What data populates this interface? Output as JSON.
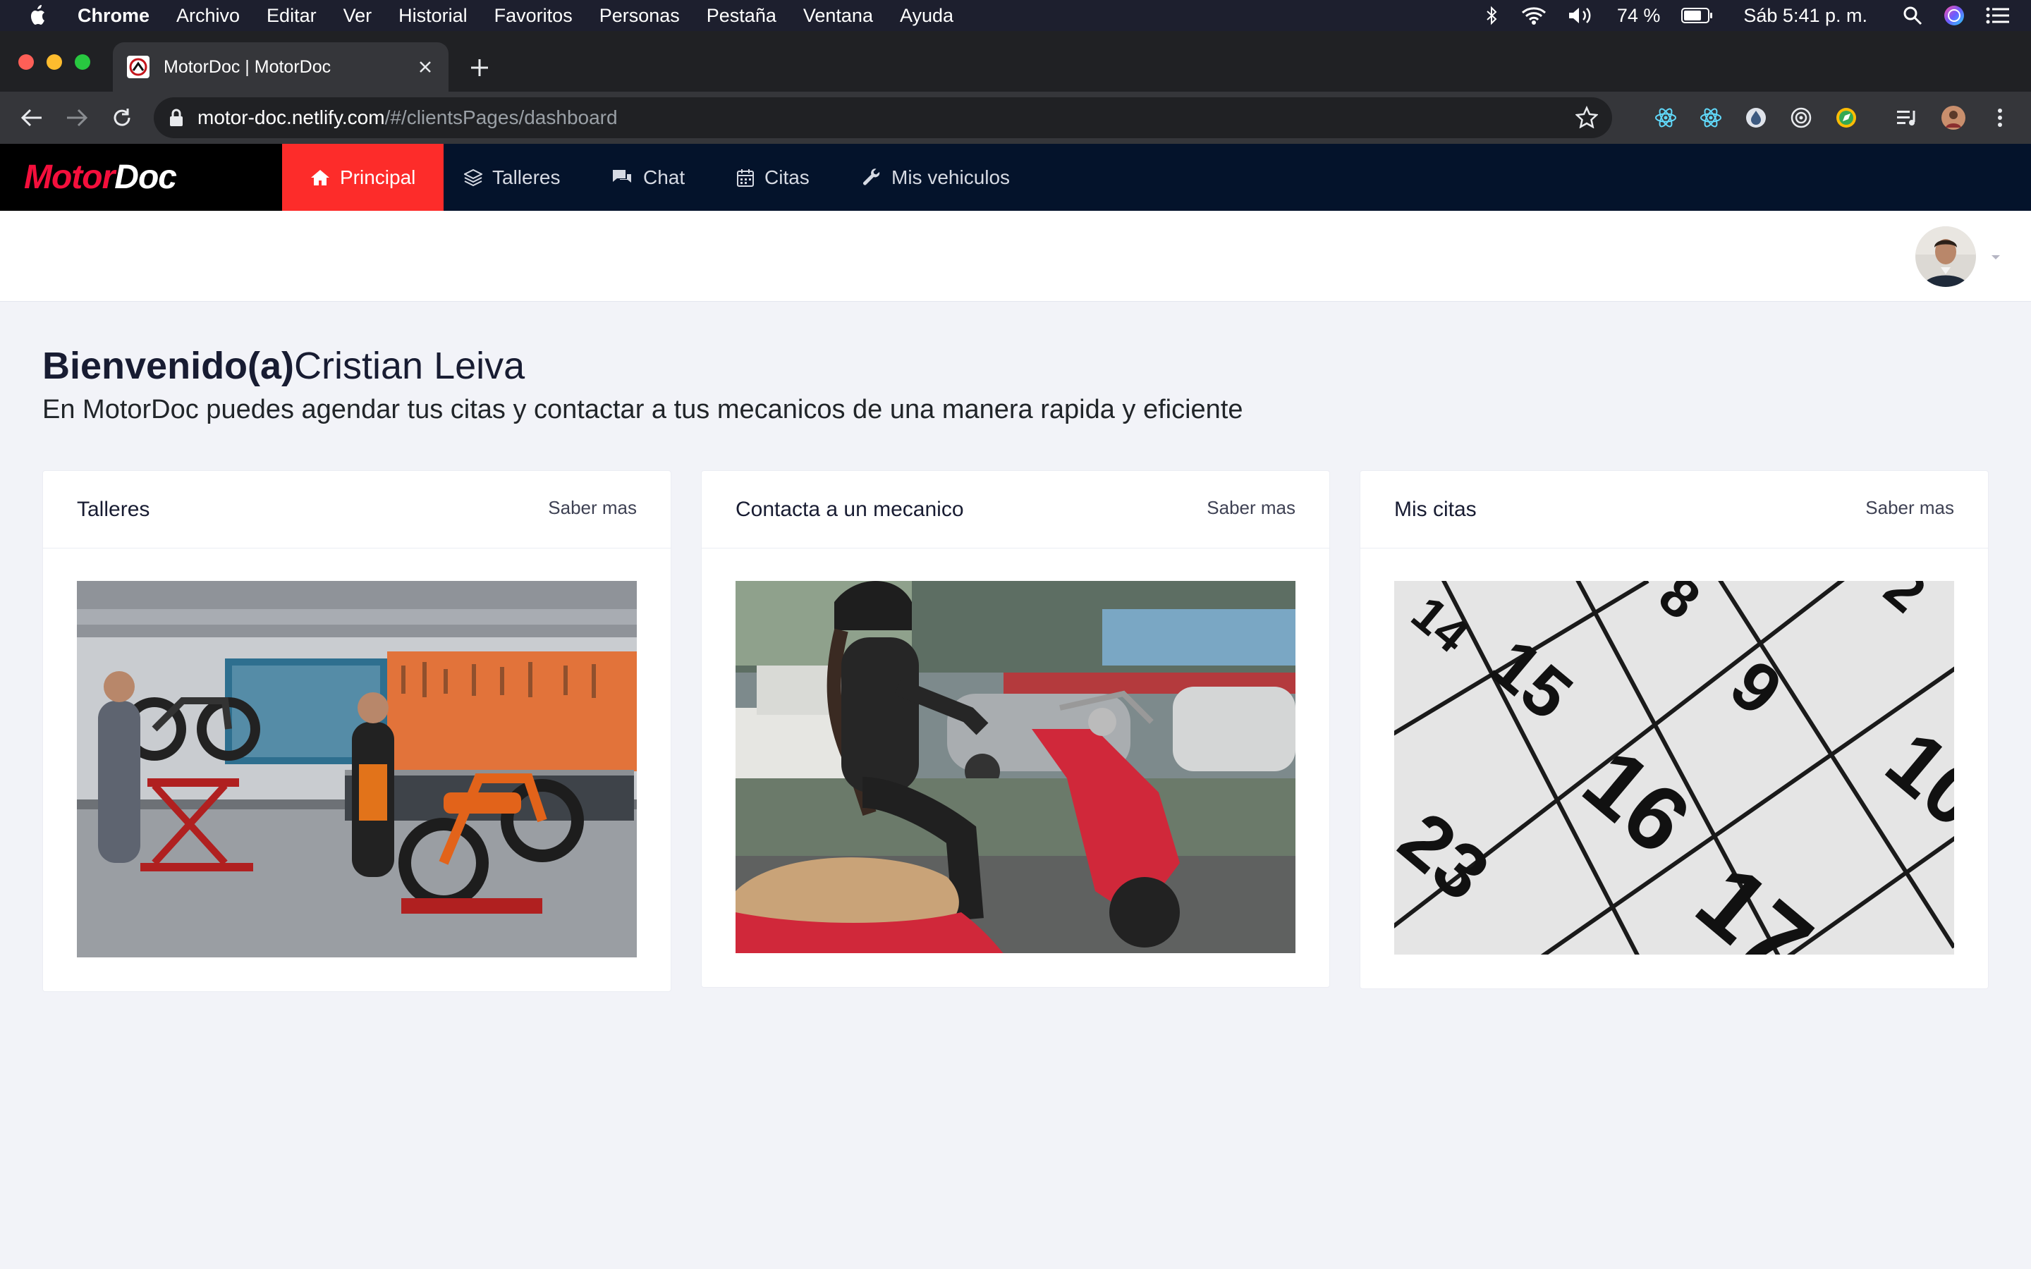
{
  "menubar": {
    "app": "Chrome",
    "items": [
      "Archivo",
      "Editar",
      "Ver",
      "Historial",
      "Favoritos",
      "Personas",
      "Pestaña",
      "Ventana",
      "Ayuda"
    ],
    "battery": "74 %",
    "clock": "Sáb 5:41 p. m."
  },
  "browser": {
    "tab_title": "MotorDoc | MotorDoc",
    "url_host": "motor-doc.netlify.com",
    "url_path": "/#/clientsPages/dashboard"
  },
  "app": {
    "logo_part1": "Motor",
    "logo_part2": "Doc",
    "nav": [
      {
        "label": "Principal",
        "icon": "home-icon",
        "active": true
      },
      {
        "label": "Talleres",
        "icon": "layers-icon"
      },
      {
        "label": "Chat",
        "icon": "chat-icon"
      },
      {
        "label": "Citas",
        "icon": "calendar-icon"
      },
      {
        "label": "Mis vehiculos",
        "icon": "wrench-icon"
      }
    ]
  },
  "welcome": {
    "greeting": "Bienvenido(a)",
    "name": "Cristian Leiva",
    "subtitle": "En MotorDoc puedes agendar tus citas y contactar a tus mecanicos de una manera rapida y eficiente"
  },
  "cards": [
    {
      "title": "Talleres",
      "link": "Saber mas",
      "image": "motorcycle-workshop"
    },
    {
      "title": "Contacta a un mecanico",
      "link": "Saber mas",
      "image": "woman-on-red-scooter"
    },
    {
      "title": "Mis citas",
      "link": "Saber mas",
      "image": "calendar-closeup"
    }
  ],
  "colors": {
    "navbar": "#04132b",
    "active_nav": "#fd2c2a",
    "logo_red": "#f40f3c",
    "page_bg": "#f2f3f8"
  }
}
